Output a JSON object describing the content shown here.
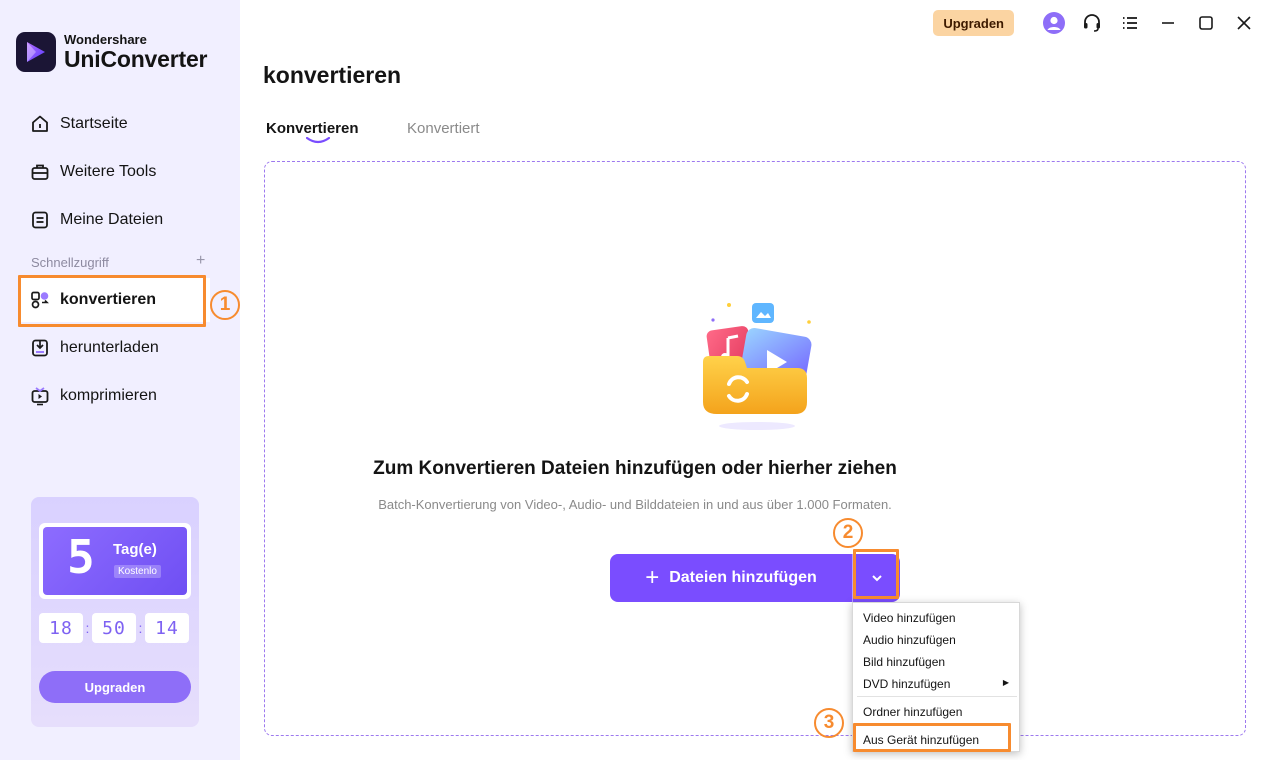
{
  "app": {
    "brand_top": "Wondershare",
    "brand_main": "UniConverter"
  },
  "sidebar": {
    "items": [
      {
        "label": "Startseite",
        "icon": "home-icon"
      },
      {
        "label": "Weitere Tools",
        "icon": "toolbox-icon"
      },
      {
        "label": "Meine Dateien",
        "icon": "file-icon"
      }
    ],
    "section_label": "Schnellzugriff",
    "section_add": "+",
    "quick": [
      {
        "label": "konvertieren",
        "icon": "convert-icon",
        "active": true
      },
      {
        "label": "herunterladen",
        "icon": "download-icon"
      },
      {
        "label": "komprimieren",
        "icon": "compress-icon"
      }
    ]
  },
  "trial": {
    "days": "5",
    "days_label": "Tag(e)",
    "free_label": "Kostenlo",
    "hours": "18",
    "minutes": "50",
    "seconds": "14",
    "button": "Upgraden"
  },
  "topbar": {
    "upgrade": "Upgraden"
  },
  "main": {
    "title": "konvertieren",
    "tabs": [
      {
        "label": "Konvertieren"
      },
      {
        "label": "Konvertiert"
      }
    ],
    "dropzone_title": "Zum Konvertieren Dateien hinzufügen oder hierher ziehen",
    "dropzone_subtitle": "Batch-Konvertierung von Video-, Audio- und Bilddateien in und aus über 1.000 Formaten.",
    "add_button": "Dateien hinzufügen",
    "add_plus": "+"
  },
  "menu": {
    "items": [
      "Video hinzufügen",
      "Audio hinzufügen",
      "Bild hinzufügen",
      "DVD hinzufügen",
      "Ordner hinzufügen",
      "Aus Gerät hinzufügen"
    ]
  },
  "annotations": {
    "one": "1",
    "two": "2",
    "three": "3"
  },
  "colors": {
    "accent": "#7a4dff",
    "highlight": "#f78b2f",
    "sidebar_bg": "#f1efff"
  }
}
